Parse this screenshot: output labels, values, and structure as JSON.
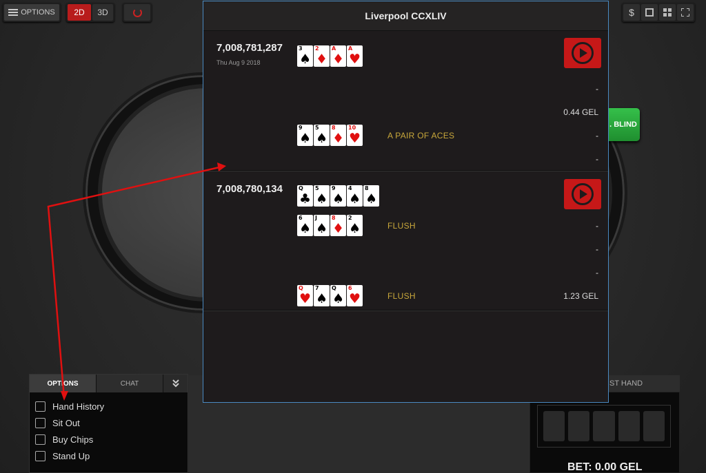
{
  "toolbar": {
    "options_label": "OPTIONS",
    "view_2d": "2D",
    "view_3d": "3D",
    "right_icons": [
      "dollar-icon",
      "window-icon",
      "grid-icon",
      "fullscreen-icon"
    ],
    "dollar_glyph": "$"
  },
  "table": {
    "blind_button_label": ". BLIND"
  },
  "hand_history": {
    "title": "Liverpool CCXLIV",
    "hands": [
      {
        "id": "7,008,781,287",
        "date": "Thu Aug 9 2018",
        "board": [
          {
            "rank": "3",
            "suit": "♠",
            "color": "black"
          },
          {
            "rank": "2",
            "suit": "♦",
            "color": "red"
          },
          {
            "rank": "A",
            "suit": "♦",
            "color": "red"
          },
          {
            "rank": "A",
            "suit": "♥",
            "color": "red"
          }
        ],
        "rows": [
          {
            "amount": "-"
          },
          {
            "amount": "0.44 GEL"
          },
          {
            "cards": [
              {
                "rank": "9",
                "suit": "♠",
                "color": "black"
              },
              {
                "rank": "5",
                "suit": "♠",
                "color": "black"
              },
              {
                "rank": "8",
                "suit": "♦",
                "color": "red"
              },
              {
                "rank": "10",
                "suit": "♥",
                "color": "red"
              }
            ],
            "hand_name": "A PAIR OF ACES",
            "amount": "-"
          },
          {
            "amount": "-"
          }
        ]
      },
      {
        "id": "7,008,780,134",
        "board": [
          {
            "rank": "Q",
            "suit": "♣",
            "color": "black"
          },
          {
            "rank": "5",
            "suit": "♠",
            "color": "black"
          },
          {
            "rank": "9",
            "suit": "♠",
            "color": "black"
          },
          {
            "rank": "4",
            "suit": "♠",
            "color": "black"
          },
          {
            "rank": "8",
            "suit": "♠",
            "color": "black"
          }
        ],
        "rows": [
          {
            "cards": [
              {
                "rank": "6",
                "suit": "♠",
                "color": "black"
              },
              {
                "rank": "J",
                "suit": "♠",
                "color": "black"
              },
              {
                "rank": "8",
                "suit": "♦",
                "color": "red"
              },
              {
                "rank": "2",
                "suit": "♠",
                "color": "black"
              }
            ],
            "hand_name": "FLUSH",
            "amount": "-"
          },
          {
            "amount": "-"
          },
          {
            "amount": "-"
          },
          {
            "cards": [
              {
                "rank": "Q",
                "suit": "♥",
                "color": "red"
              },
              {
                "rank": "7",
                "suit": "♠",
                "color": "black"
              },
              {
                "rank": "Q",
                "suit": "♠",
                "color": "black"
              },
              {
                "rank": "6",
                "suit": "♥",
                "color": "red"
              }
            ],
            "hand_name": "FLUSH",
            "amount": "1.23 GEL"
          }
        ]
      }
    ]
  },
  "options_panel": {
    "tabs": [
      "OPTIONS",
      "CHAT"
    ],
    "collapse_glyph": "⌄",
    "items": [
      "Hand History",
      "Sit Out",
      "Buy Chips",
      "Stand Up"
    ]
  },
  "bet_panel": {
    "tab_label": "ST HAND",
    "bet_text": "BET: 0.00 GEL"
  },
  "colors": {
    "accent_red": "#c61818",
    "hand_name_gold": "#c9a83b",
    "modal_border": "#4a8ac2"
  }
}
